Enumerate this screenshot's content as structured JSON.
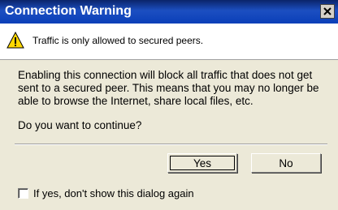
{
  "window": {
    "title": "Connection Warning",
    "close_icon": "close-icon"
  },
  "info": {
    "icon": "warning-icon",
    "text": "Traffic is only allowed to secured peers."
  },
  "message": {
    "body": "Enabling this connection will block all traffic that does not get sent to a secured peer. This means that you may no longer be able to browse the Internet, share local files, etc.",
    "question": "Do you want to continue?"
  },
  "buttons": {
    "yes_label": "Yes",
    "no_label": "No"
  },
  "checkbox": {
    "label": "If yes, don't show this dialog again",
    "checked": false
  }
}
